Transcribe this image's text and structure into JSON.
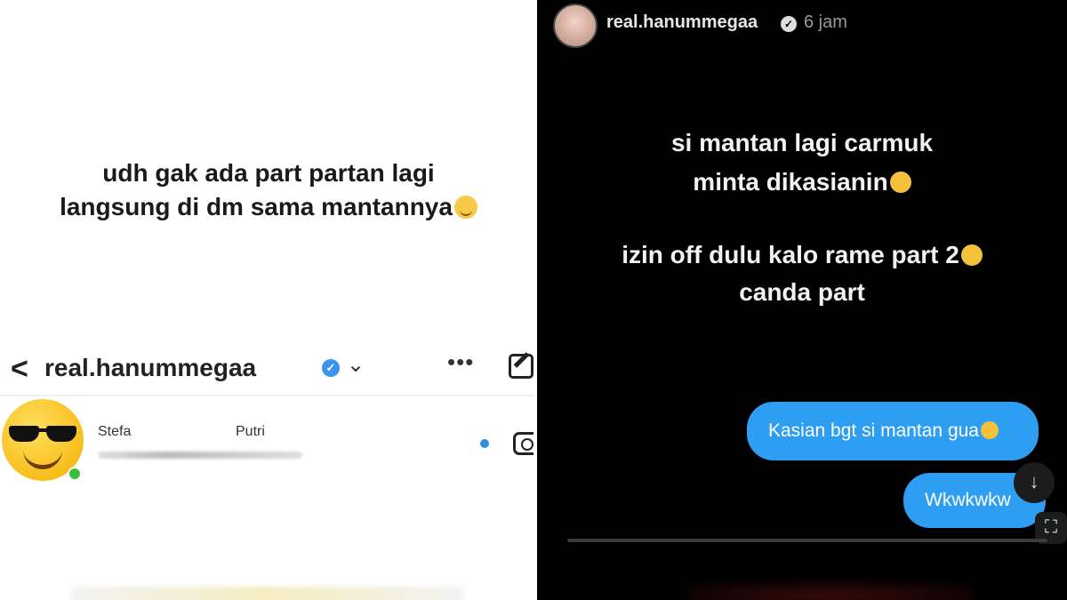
{
  "left": {
    "caption_lines": [
      "udh gak ada part partan lagi",
      "langsung di dm sama mantannya"
    ],
    "dm_header": {
      "back_icon": "chevron-left-icon",
      "username": "real.hanummegaa",
      "verified_icon": "verified-badge-icon",
      "dropdown_icon": "chevron-down-icon",
      "more_icon": "more-horizontal-icon",
      "edit_icon": "new-message-icon"
    },
    "contact": {
      "avatar_icon": "sunglasses-emoji-icon",
      "name_part1": "Stefa",
      "name_part2": "Putri",
      "unread_color": "#2f8de0",
      "camera_icon": "camera-icon"
    }
  },
  "right": {
    "story_header": {
      "username": "real.hanummegaa",
      "verified_icon": "verified-badge-icon",
      "time": "6 jam"
    },
    "story_text": {
      "line1": "si mantan lagi carmuk",
      "line2": "minta dikasianin",
      "line3": "izin off dulu kalo rame part 2",
      "line4": "canda part"
    },
    "bubbles": [
      {
        "text": "Kasian bgt si mantan gua"
      },
      {
        "text": "Wkwkwkw"
      }
    ],
    "scroll_icon": "arrow-down-icon",
    "scan_icon": "scan-icon",
    "bubble_color": "#2d9ef2"
  }
}
